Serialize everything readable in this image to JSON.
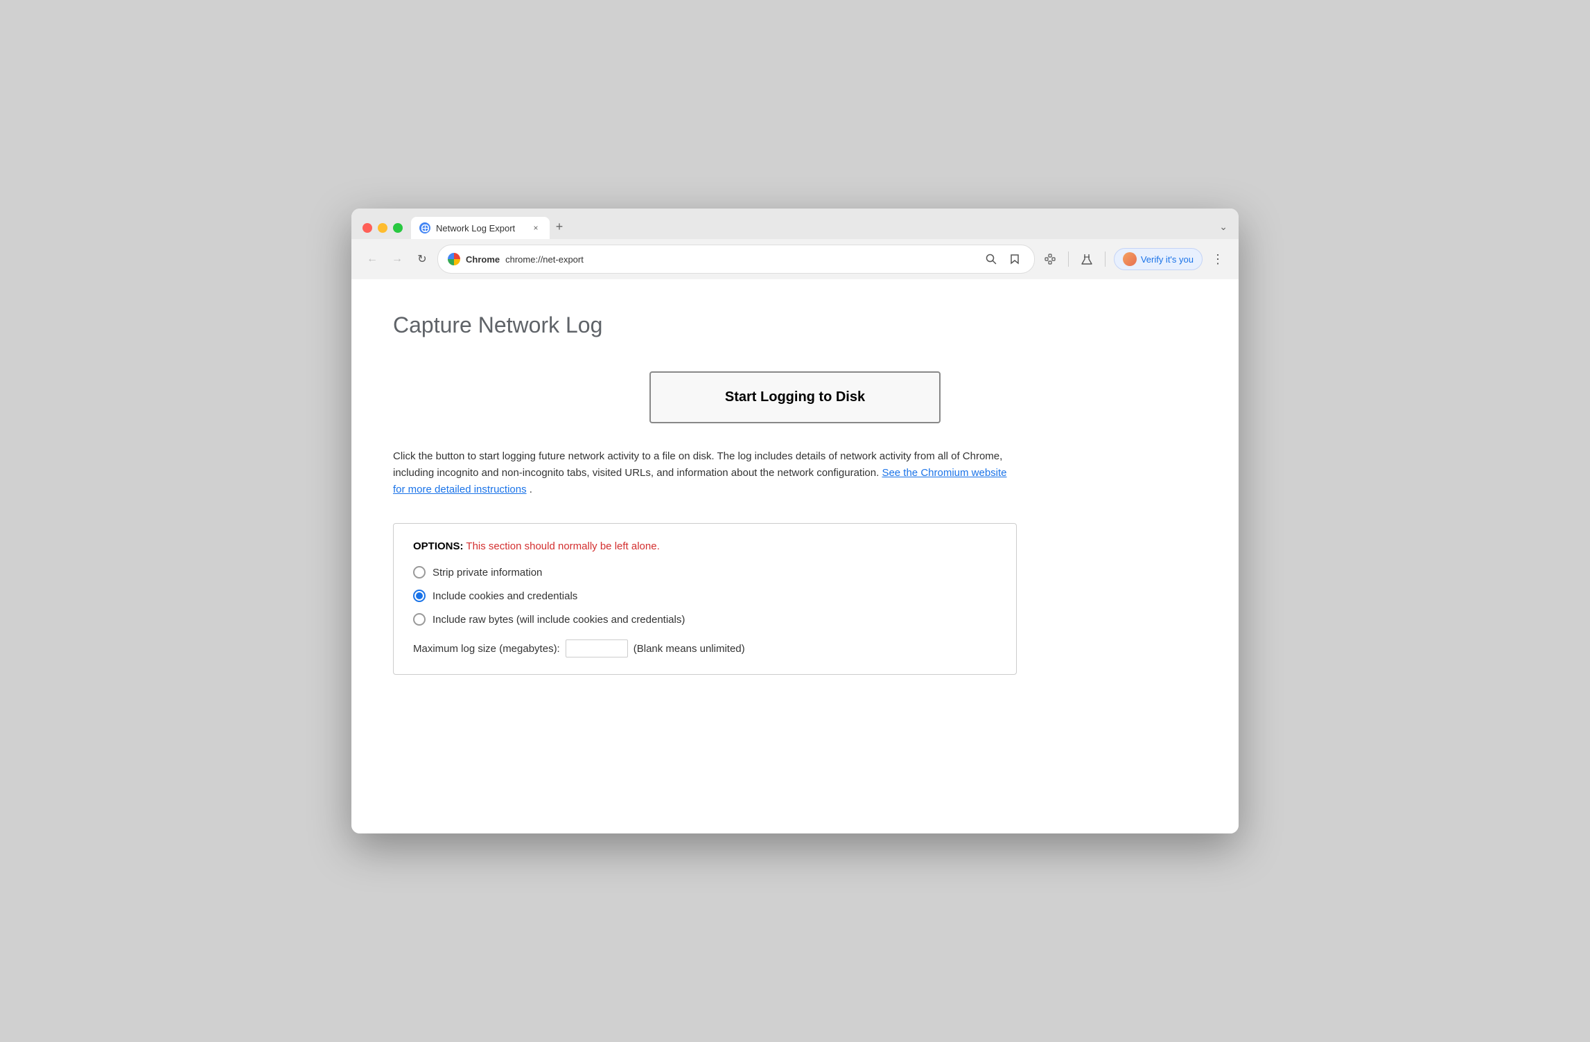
{
  "window": {
    "title": "Network Log Export"
  },
  "tab": {
    "favicon": "globe",
    "label": "Network Log Export",
    "close_icon": "×"
  },
  "new_tab_button": "+",
  "chevron_button": "⌄",
  "nav": {
    "back_icon": "←",
    "forward_icon": "→",
    "refresh_icon": "↻"
  },
  "address_bar": {
    "browser_label": "Chrome",
    "url": "chrome://net-export"
  },
  "toolbar": {
    "search_icon": "🔍",
    "bookmark_icon": "☆",
    "extension_icon": "🧩",
    "labs_icon": "⚗",
    "menu_icon": "⋮",
    "verify_label": "Verify it's you"
  },
  "page": {
    "title": "Capture Network Log",
    "start_button_label": "Start Logging to Disk",
    "description_text": "Click the button to start logging future network activity to a file on disk. The log includes details of network activity from all of Chrome, including incognito and non-incognito tabs, visited URLs, and information about the network configuration. ",
    "link_text": "See the Chromium website for more detailed instructions",
    "link_suffix": ".",
    "options": {
      "header_bold": "OPTIONS:",
      "header_warning": " This section should normally be left alone.",
      "radio_items": [
        {
          "id": "strip",
          "label": "Strip private information",
          "checked": false
        },
        {
          "id": "include_cookies",
          "label": "Include cookies and credentials",
          "checked": true
        },
        {
          "id": "include_raw",
          "label": "Include raw bytes (will include cookies and credentials)",
          "checked": false
        }
      ],
      "max_log_label": "Maximum log size (megabytes):",
      "max_log_placeholder": "",
      "max_log_hint": "(Blank means unlimited)"
    }
  }
}
